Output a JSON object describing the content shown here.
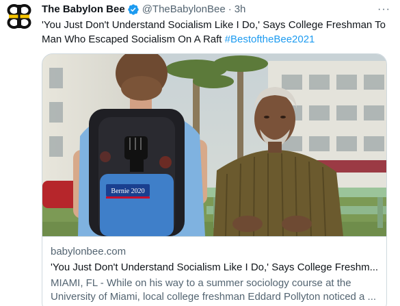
{
  "author": {
    "name": "The Babylon Bee",
    "handle": "@TheBabylonBee",
    "time": "3h",
    "verified": true,
    "avatar_icon": "babylon-bee-logo-icon"
  },
  "more_label": "···",
  "tweet": {
    "text": "'You Just Don't Understand Socialism Like I Do,' Says College Freshman To Man Who Escaped Socialism On A Raft ",
    "hashtag": "#BestoftheBee2021"
  },
  "card": {
    "domain": "babylonbee.com",
    "title": "'You Just Don't Understand Socialism Like I Do,' Says College Freshm...",
    "description": "MIAMI, FL - While on his way to a summer sociology course at the University of Miami, local college freshman Eddard Pollyton noticed a ...",
    "image": {
      "patch_text": "Bernie 2020"
    }
  },
  "colors": {
    "accent": "#1d9bf0",
    "secondary_text": "#536471",
    "border": "#cfd9de"
  }
}
